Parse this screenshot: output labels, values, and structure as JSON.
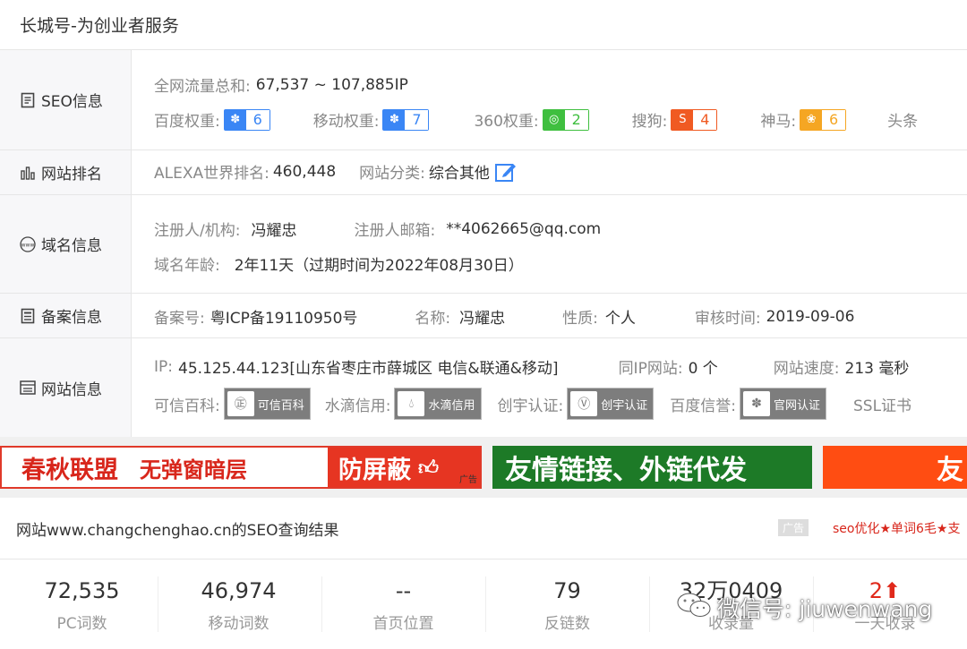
{
  "header": {
    "title": "长城号-为创业者服务"
  },
  "seo": {
    "label": "SEO信息",
    "traffic_key": "全网流量总和:",
    "traffic_val": "67,537 ~ 107,885IP",
    "weights": [
      {
        "key": "百度权重:",
        "value": "6",
        "color": "#3a86f5",
        "icon": "paw-icon"
      },
      {
        "key": "移动权重:",
        "value": "7",
        "color": "#3a86f5",
        "icon": "paw-icon"
      },
      {
        "key": "360权重:",
        "value": "2",
        "color": "#3fbf3f",
        "icon": "360-icon"
      },
      {
        "key": "搜狗:",
        "value": "4",
        "color": "#f05a22",
        "icon": "sogou-icon"
      },
      {
        "key": "神马:",
        "value": "6",
        "color": "#f5a623",
        "icon": "shenma-icon"
      }
    ],
    "overflow_key": "头条"
  },
  "rank": {
    "label": "网站排名",
    "alexa_key": "ALEXA世界排名:",
    "alexa_val": "460,448",
    "category_key": "网站分类:",
    "category_val": "综合其他"
  },
  "domain": {
    "label": "域名信息",
    "registrant_key": "注册人/机构:",
    "registrant_val": "冯耀忠",
    "email_key": "注册人邮箱:",
    "email_val": "**4062665@qq.com",
    "age_key": "域名年龄:",
    "age_val": "2年11天（过期时间为2022年08月30日）"
  },
  "icp": {
    "label": "备案信息",
    "no_key": "备案号:",
    "no_val": "粤ICP备19110950号",
    "name_key": "名称:",
    "name_val": "冯耀忠",
    "type_key": "性质:",
    "type_val": "个人",
    "date_key": "审核时间:",
    "date_val": "2019-09-06"
  },
  "site": {
    "label": "网站信息",
    "ip_key": "IP:",
    "ip_val": "45.125.44.123[山东省枣庄市薛城区 电信&联通&移动]",
    "sameip_key": "同IP网站:",
    "sameip_val": "0 个",
    "speed_key": "网站速度:",
    "speed_val": "213 毫秒",
    "seals": [
      {
        "key": "可信百科:",
        "label": "可信百科"
      },
      {
        "key": "水滴信用:",
        "label": "水滴信用"
      },
      {
        "key": "创宇认证:",
        "label": "创宇认证"
      },
      {
        "key": "百度信誉:",
        "label": "官网认证"
      }
    ],
    "overflow_key": "SSL证书"
  },
  "ads": {
    "ad1_part1": "春秋联盟",
    "ad1_part2": "无弹窗暗层",
    "ad1_part3": "防屏蔽",
    "ad_tag": "广告",
    "ad2": "友情链接、外链代发",
    "ad3": "友"
  },
  "result": {
    "title": "网站www.changchenghao.cn的SEO查询结果",
    "ad_label": "广告",
    "ad_text": "seo优化★单词6毛★支"
  },
  "stats": [
    {
      "value": "72,535",
      "label": "PC词数"
    },
    {
      "value": "46,974",
      "label": "移动词数"
    },
    {
      "value": "--",
      "label": "首页位置"
    },
    {
      "value": "79",
      "label": "反链数"
    },
    {
      "value": "32万0409",
      "label": "收录量"
    },
    {
      "value": "2",
      "label": "一天收录"
    }
  ],
  "watermark": {
    "text": "微信号: jiuwenwang"
  },
  "colors": {
    "accent_red": "#e0291b",
    "label_bg": "#f7f7f9"
  }
}
